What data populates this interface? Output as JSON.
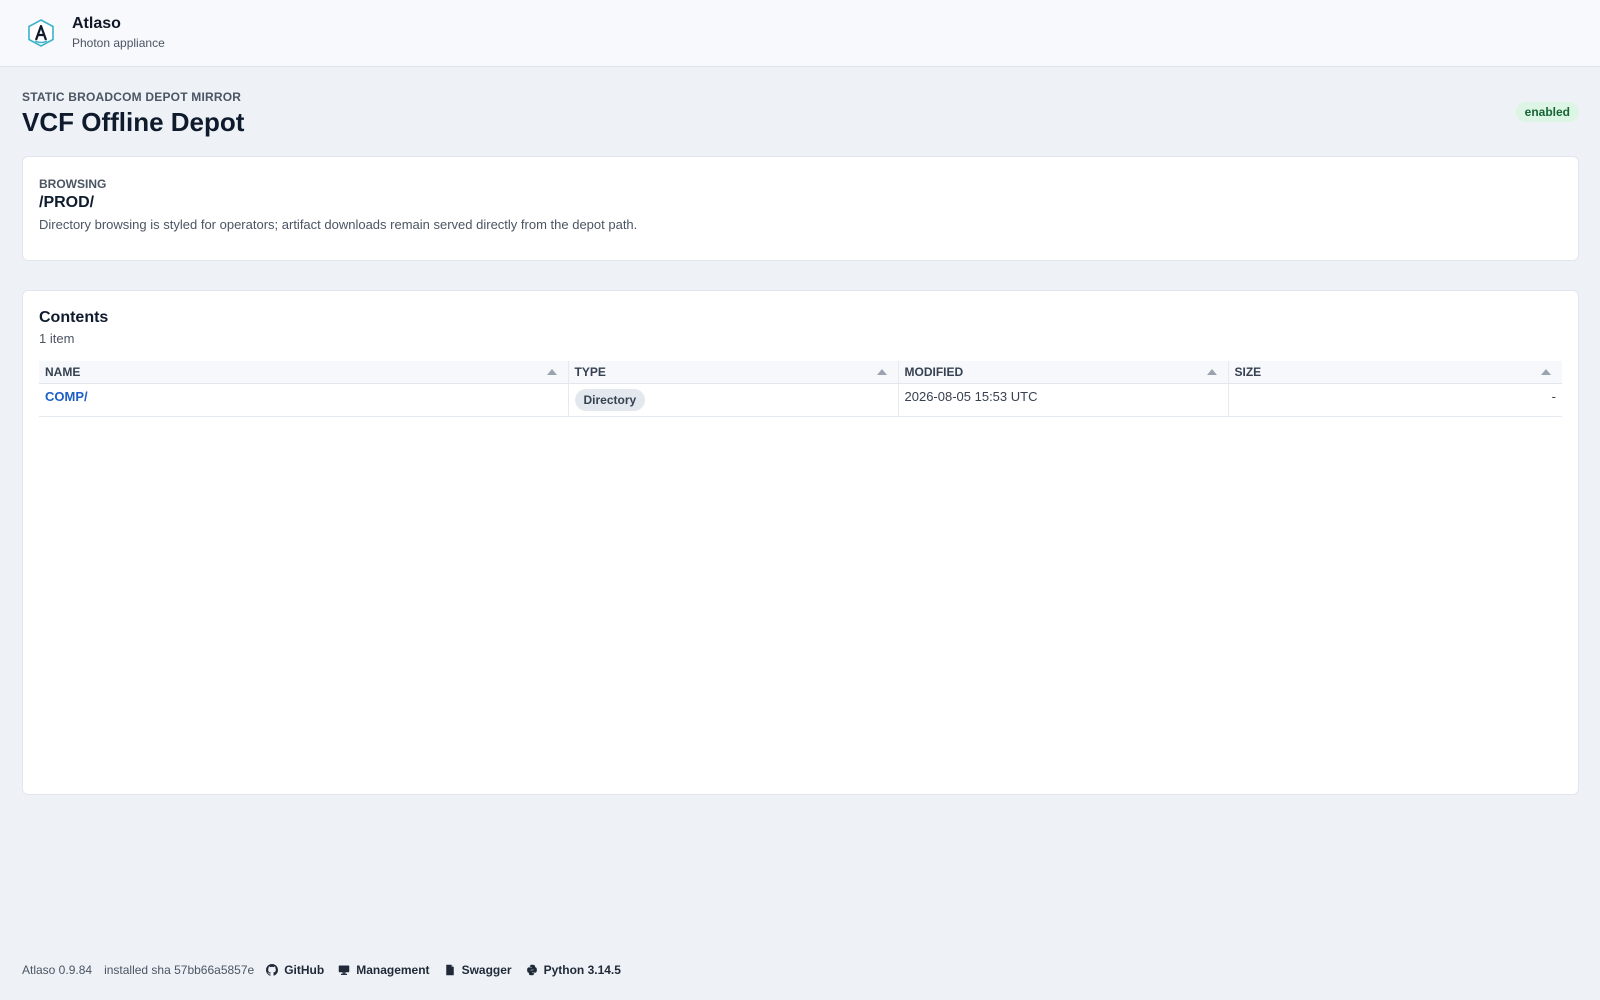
{
  "app": {
    "name": "Atlaso",
    "subtitle": "Photon appliance"
  },
  "page": {
    "eyebrow": "STATIC BROADCOM DEPOT MIRROR",
    "title": "VCF Offline Depot",
    "status_badge": "enabled"
  },
  "browse": {
    "label": "BROWSING",
    "path": "/PROD/",
    "description": "Directory browsing is styled for operators; artifact downloads remain served directly from the depot path."
  },
  "contents": {
    "title": "Contents",
    "count": "1 item",
    "columns": [
      "NAME",
      "TYPE",
      "MODIFIED",
      "SIZE"
    ],
    "rows": [
      {
        "name": "COMP/",
        "type": "Directory",
        "modified": "2026-08-05 15:53 UTC",
        "size": "-"
      }
    ]
  },
  "footer": {
    "version": "Atlaso 0.9.84",
    "sha": "installed sha 57bb66a5857e",
    "links": [
      {
        "label": "GitHub",
        "icon": "github-icon"
      },
      {
        "label": "Management",
        "icon": "monitor-icon"
      },
      {
        "label": "Swagger",
        "icon": "document-icon"
      },
      {
        "label": "Python 3.14.5",
        "icon": "python-icon"
      }
    ]
  },
  "colors": {
    "accent_link": "#1d5fc4",
    "badge_bg": "#dcf5e4",
    "badge_text": "#166534",
    "page_bg": "#eef2f7"
  }
}
